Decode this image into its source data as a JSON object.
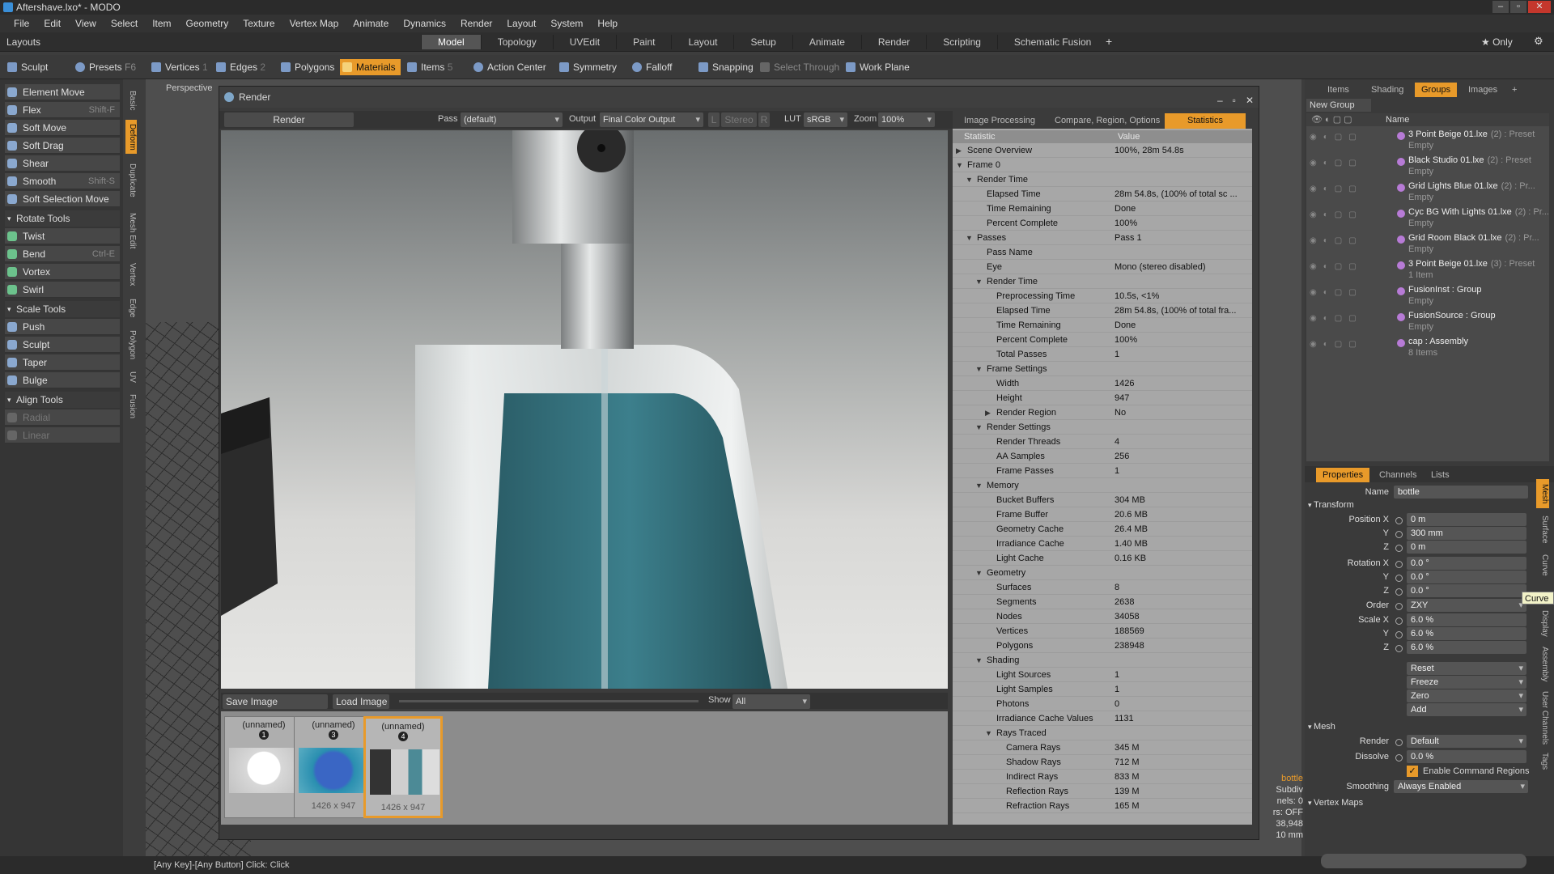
{
  "window": {
    "title": "Aftershave.lxo* - MODO"
  },
  "menu": [
    "File",
    "Edit",
    "View",
    "Select",
    "Item",
    "Geometry",
    "Texture",
    "Vertex Map",
    "Animate",
    "Dynamics",
    "Render",
    "Layout",
    "System",
    "Help"
  ],
  "layouts": {
    "label": "Layouts",
    "tabs": [
      "Model",
      "Topology",
      "UVEdit",
      "Paint",
      "Layout",
      "Setup",
      "Animate",
      "Render",
      "Scripting",
      "Schematic Fusion"
    ],
    "active": "Model",
    "only": "Only"
  },
  "toolbar": {
    "sculpt": "Sculpt",
    "presets": "Presets",
    "presets_key": "F6",
    "vertices": "Vertices",
    "vertices_num": "1",
    "edges": "Edges",
    "edges_num": "2",
    "polygons": "Polygons",
    "materials": "Materials",
    "items": "Items",
    "items_num": "5",
    "action_center": "Action Center",
    "symmetry": "Symmetry",
    "falloff": "Falloff",
    "snapping": "Snapping",
    "select_through": "Select Through",
    "work_plane": "Work Plane"
  },
  "left_tools": {
    "items": [
      {
        "label": "Element Move",
        "key": ""
      },
      {
        "label": "Flex",
        "key": "Shift-F"
      },
      {
        "label": "Soft Move",
        "key": ""
      },
      {
        "label": "Soft Drag",
        "key": ""
      },
      {
        "label": "Shear",
        "key": ""
      },
      {
        "label": "Smooth",
        "key": "Shift-S"
      },
      {
        "label": "Soft Selection Move",
        "key": ""
      }
    ],
    "rotate_title": "Rotate Tools",
    "rotate": [
      {
        "label": "Twist",
        "key": ""
      },
      {
        "label": "Bend",
        "key": "Ctrl-E"
      },
      {
        "label": "Vortex",
        "key": ""
      },
      {
        "label": "Swirl",
        "key": ""
      }
    ],
    "scale_title": "Scale Tools",
    "scale": [
      {
        "label": "Push",
        "key": ""
      },
      {
        "label": "Sculpt",
        "key": ""
      },
      {
        "label": "Taper",
        "key": ""
      },
      {
        "label": "Bulge",
        "key": ""
      }
    ],
    "align_title": "Align Tools",
    "align": [
      {
        "label": "Radial"
      },
      {
        "label": "Linear"
      }
    ]
  },
  "vertical_tabs": [
    "Basic",
    "Deform",
    "Duplicate",
    "Mesh Edit",
    "Vertex",
    "Edge",
    "Polygon",
    "UV",
    "Fusion"
  ],
  "viewport": {
    "label": "Perspective"
  },
  "render_window": {
    "title": "Render",
    "render_button": "Render",
    "pass_label": "Pass",
    "pass_value": "(default)",
    "output_label": "Output",
    "output_value": "Final Color Output",
    "l_btn": "L",
    "stereo_btn": "Stereo",
    "r_btn": "R",
    "lut_label": "LUT",
    "lut_value": "sRGB",
    "zoom_label": "Zoom",
    "zoom_value": "100%",
    "save_image": "Save Image",
    "load_image": "Load Image",
    "show_label": "Show",
    "show_value": "All",
    "thumbs": [
      {
        "name": "(unnamed)",
        "num": "1",
        "size": ""
      },
      {
        "name": "(unnamed)",
        "num": "3",
        "size": "1426 x 947"
      },
      {
        "name": "(unnamed)",
        "num": "4",
        "size": "1426 x 947"
      }
    ]
  },
  "stats": {
    "tabs": [
      "Image Processing",
      "Compare, Region, Options",
      "Statistics"
    ],
    "active_tab": "Statistics",
    "col_stat": "Statistic",
    "col_value": "Value",
    "rows": [
      {
        "k": "Scene Overview",
        "v": "100%, 28m 54.8s",
        "d": 0,
        "a": "▶"
      },
      {
        "k": "Frame 0",
        "v": "",
        "d": 0,
        "a": "▼"
      },
      {
        "k": "Render Time",
        "v": "",
        "d": 1,
        "a": "▼"
      },
      {
        "k": "Elapsed Time",
        "v": "28m 54.8s, (100% of total sc ...",
        "d": 2,
        "a": ""
      },
      {
        "k": "Time Remaining",
        "v": "Done",
        "d": 2,
        "a": ""
      },
      {
        "k": "Percent Complete",
        "v": "100%",
        "d": 2,
        "a": ""
      },
      {
        "k": "Passes",
        "v": "Pass 1",
        "d": 1,
        "a": "▼"
      },
      {
        "k": "Pass Name",
        "v": "",
        "d": 2,
        "a": ""
      },
      {
        "k": "Eye",
        "v": "Mono (stereo disabled)",
        "d": 2,
        "a": ""
      },
      {
        "k": "Render Time",
        "v": "",
        "d": 2,
        "a": "▼"
      },
      {
        "k": "Preprocessing Time",
        "v": "10.5s, <1%",
        "d": 3,
        "a": ""
      },
      {
        "k": "Elapsed Time",
        "v": "28m 54.8s, (100% of total fra...",
        "d": 3,
        "a": ""
      },
      {
        "k": "Time Remaining",
        "v": "Done",
        "d": 3,
        "a": ""
      },
      {
        "k": "Percent Complete",
        "v": "100%",
        "d": 3,
        "a": ""
      },
      {
        "k": "Total Passes",
        "v": "1",
        "d": 3,
        "a": ""
      },
      {
        "k": "Frame Settings",
        "v": "",
        "d": 2,
        "a": "▼"
      },
      {
        "k": "Width",
        "v": "1426",
        "d": 3,
        "a": ""
      },
      {
        "k": "Height",
        "v": "947",
        "d": 3,
        "a": ""
      },
      {
        "k": "Render Region",
        "v": "No",
        "d": 3,
        "a": "▶"
      },
      {
        "k": "Render Settings",
        "v": "",
        "d": 2,
        "a": "▼"
      },
      {
        "k": "Render Threads",
        "v": "4",
        "d": 3,
        "a": ""
      },
      {
        "k": "AA Samples",
        "v": "256",
        "d": 3,
        "a": ""
      },
      {
        "k": "Frame Passes",
        "v": "1",
        "d": 3,
        "a": ""
      },
      {
        "k": "Memory",
        "v": "",
        "d": 2,
        "a": "▼"
      },
      {
        "k": "Bucket Buffers",
        "v": "304 MB",
        "d": 3,
        "a": ""
      },
      {
        "k": "Frame Buffer",
        "v": "20.6 MB",
        "d": 3,
        "a": ""
      },
      {
        "k": "Geometry Cache",
        "v": "26.4 MB",
        "d": 3,
        "a": ""
      },
      {
        "k": "Irradiance Cache",
        "v": "1.40 MB",
        "d": 3,
        "a": ""
      },
      {
        "k": "Light Cache",
        "v": "0.16 KB",
        "d": 3,
        "a": ""
      },
      {
        "k": "Geometry",
        "v": "",
        "d": 2,
        "a": "▼"
      },
      {
        "k": "Surfaces",
        "v": "8",
        "d": 3,
        "a": ""
      },
      {
        "k": "Segments",
        "v": "2638",
        "d": 3,
        "a": ""
      },
      {
        "k": "Nodes",
        "v": "34058",
        "d": 3,
        "a": ""
      },
      {
        "k": "Vertices",
        "v": "188569",
        "d": 3,
        "a": ""
      },
      {
        "k": "Polygons",
        "v": "238948",
        "d": 3,
        "a": ""
      },
      {
        "k": "Shading",
        "v": "",
        "d": 2,
        "a": "▼"
      },
      {
        "k": "Light Sources",
        "v": "1",
        "d": 3,
        "a": ""
      },
      {
        "k": "Light Samples",
        "v": "1",
        "d": 3,
        "a": ""
      },
      {
        "k": "Photons",
        "v": "0",
        "d": 3,
        "a": ""
      },
      {
        "k": "Irradiance Cache Values",
        "v": "1131",
        "d": 3,
        "a": ""
      },
      {
        "k": "Rays Traced",
        "v": "",
        "d": 3,
        "a": "▼"
      },
      {
        "k": "Camera Rays",
        "v": "345 M",
        "d": 4,
        "a": ""
      },
      {
        "k": "Shadow Rays",
        "v": "712 M",
        "d": 4,
        "a": ""
      },
      {
        "k": "Indirect Rays",
        "v": "833 M",
        "d": 4,
        "a": ""
      },
      {
        "k": "Reflection Rays",
        "v": "139 M",
        "d": 4,
        "a": ""
      },
      {
        "k": "Refraction Rays",
        "v": "165 M",
        "d": 4,
        "a": ""
      }
    ]
  },
  "groups": {
    "tabs": [
      "Items",
      "Shading",
      "Groups",
      "Images"
    ],
    "active": "Groups",
    "new_group": "New Group",
    "col_name": "Name",
    "items": [
      {
        "name": "3 Point Beige 01.lxe",
        "extra": "(2) : Preset",
        "sub": "Empty"
      },
      {
        "name": "Black Studio 01.lxe",
        "extra": "(2) : Preset",
        "sub": "Empty"
      },
      {
        "name": "Grid Lights Blue 01.lxe",
        "extra": "(2) : Pr...",
        "sub": "Empty"
      },
      {
        "name": "Cyc BG With Lights 01.lxe",
        "extra": "(2) : Pr...",
        "sub": "Empty"
      },
      {
        "name": "Grid Room Black 01.lxe",
        "extra": "(2) : Pr...",
        "sub": "Empty"
      },
      {
        "name": "3 Point Beige 01.lxe",
        "extra": "(3) : Preset",
        "sub": "1 Item"
      },
      {
        "name": "FusionInst : Group",
        "extra": "",
        "sub": "Empty"
      },
      {
        "name": "FusionSource : Group",
        "extra": "",
        "sub": "Empty"
      },
      {
        "name": "cap : Assembly",
        "extra": "",
        "sub": "8 Items"
      }
    ]
  },
  "properties": {
    "tabs": [
      "Properties",
      "Channels",
      "Lists"
    ],
    "active": "Properties",
    "name_label": "Name",
    "name_value": "bottle",
    "transform": "Transform",
    "position_label": "Position X",
    "pos": [
      "0 m",
      "300 mm",
      "0 m"
    ],
    "rotation_label": "Rotation X",
    "rot": [
      "0.0 °",
      "0.0 °",
      "0.0 °"
    ],
    "order_label": "Order",
    "order": "ZXY",
    "scale_label": "Scale X",
    "scale": [
      "6.0 %",
      "6.0 %",
      "6.0 %"
    ],
    "y": "Y",
    "z": "Z",
    "actions": [
      "Reset",
      "Freeze",
      "Zero",
      "Add"
    ],
    "mesh": "Mesh",
    "render_label": "Render",
    "render_value": "Default",
    "dissolve_label": "Dissolve",
    "dissolve_value": "0.0 %",
    "enable_cmd": "Enable Command Regions",
    "smoothing_label": "Smoothing",
    "smoothing_value": "Always Enabled",
    "vertex_maps": "Vertex Maps"
  },
  "right_vtabs": [
    "Mesh",
    "Surface",
    "Curve",
    "Display",
    "Assembly",
    "User Channels",
    "Tags"
  ],
  "tooltip": "Curve",
  "viewport_info": [
    "bottle",
    "Subdiv",
    "nels: 0",
    "rs: OFF",
    "38,948",
    "10 mm"
  ],
  "status": "[Any Key]-[Any Button] Click:  Click"
}
